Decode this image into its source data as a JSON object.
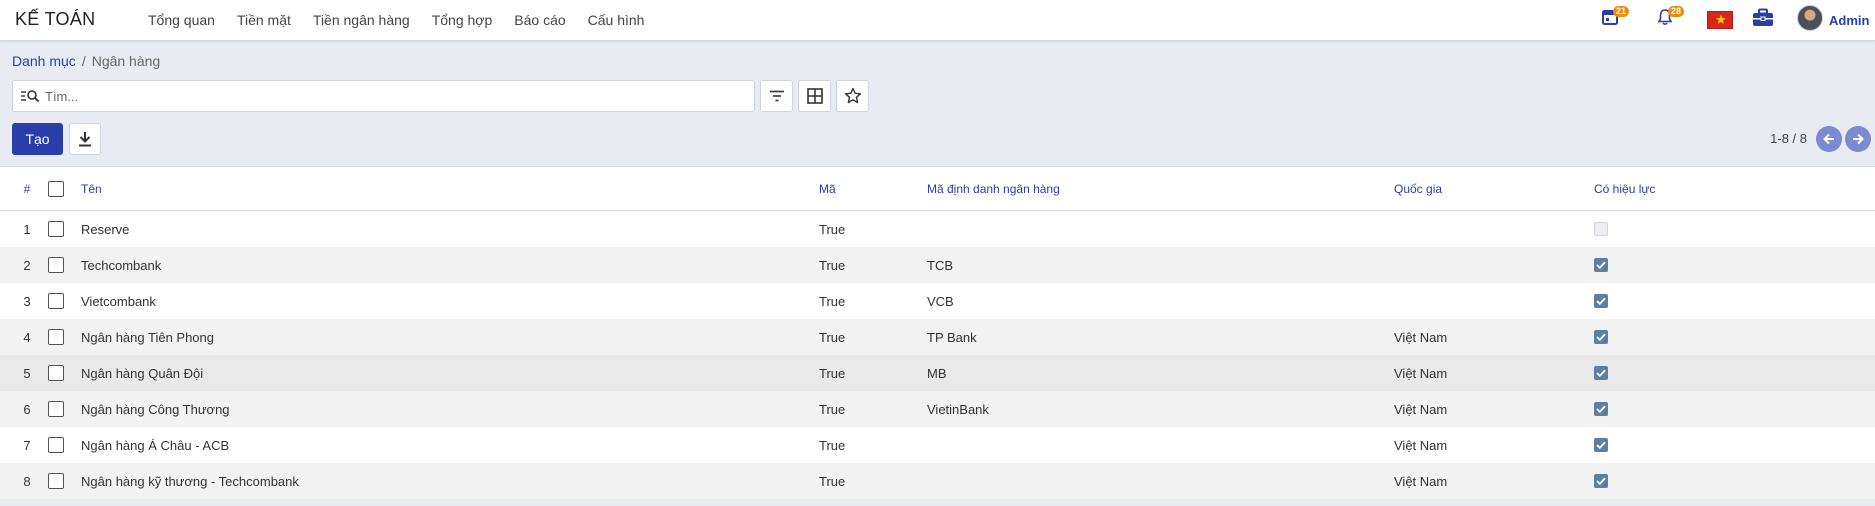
{
  "app": {
    "title": "KẾ TOÁN",
    "menu": [
      "Tổng quan",
      "Tiền mặt",
      "Tiền ngân hàng",
      "Tổng hợp",
      "Báo cáo",
      "Cấu hình"
    ],
    "calendar_badge": "21",
    "notification_badge": "28",
    "user": "Admin"
  },
  "breadcrumb": {
    "parent": "Danh mục",
    "separator": "/",
    "current": "Ngân hàng"
  },
  "search": {
    "placeholder": "Tìm...",
    "value": ""
  },
  "toolbar": {
    "create_label": "Tạo"
  },
  "pager": {
    "text": "1-8 / 8"
  },
  "table": {
    "headers": {
      "num": "#",
      "name": "Tên",
      "code": "Mã",
      "bic": "Mã định danh ngân hàng",
      "country": "Quốc gia",
      "active": "Có hiệu lực"
    },
    "rows": [
      {
        "num": "1",
        "name": "Reserve",
        "code": "True",
        "bic": "",
        "country": "",
        "active": false
      },
      {
        "num": "2",
        "name": "Techcombank",
        "code": "True",
        "bic": "TCB",
        "country": "",
        "active": true
      },
      {
        "num": "3",
        "name": "Vietcombank",
        "code": "True",
        "bic": "VCB",
        "country": "",
        "active": true
      },
      {
        "num": "4",
        "name": "Ngân hàng Tiên Phong",
        "code": "True",
        "bic": "TP Bank",
        "country": "Việt Nam",
        "active": true
      },
      {
        "num": "5",
        "name": "Ngân hàng Quân Đội",
        "code": "True",
        "bic": "MB",
        "country": "Việt Nam",
        "active": true
      },
      {
        "num": "6",
        "name": "Ngân hàng Công Thương",
        "code": "True",
        "bic": "VietinBank",
        "country": "Việt Nam",
        "active": true
      },
      {
        "num": "7",
        "name": "Ngân hàng Á Châu - ACB",
        "code": "True",
        "bic": "",
        "country": "Việt Nam",
        "active": true
      },
      {
        "num": "8",
        "name": "Ngân hàng kỹ thương - Techcombank",
        "code": "True",
        "bic": "",
        "country": "Việt Nam",
        "active": true
      }
    ]
  },
  "colors": {
    "primary": "#2a3eaa",
    "badge": "#f08a0c",
    "checkbox_on": "#5d7fa6"
  }
}
